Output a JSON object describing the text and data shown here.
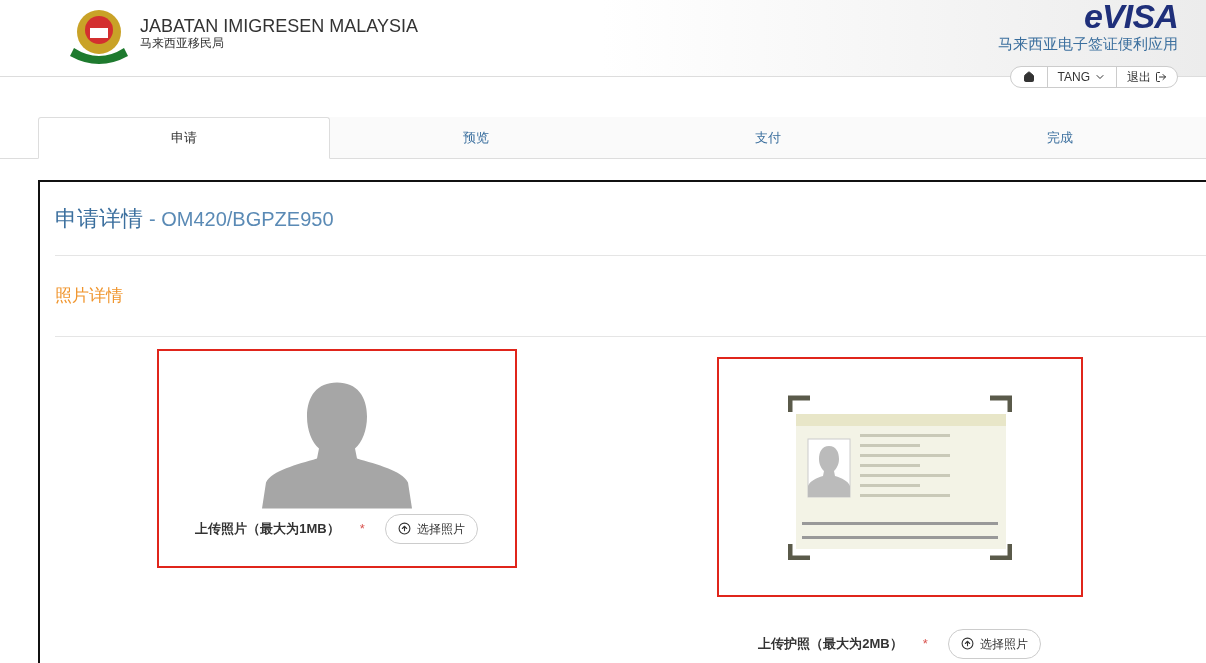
{
  "header": {
    "agency": "JABATAN IMIGRESEN MALAYSIA",
    "agency_zh": "马来西亚移民局",
    "logo_text": "eVISA",
    "app_name": "马来西亚电子签证便利应用",
    "user_menu": {
      "user": "TANG",
      "logout": "退出"
    }
  },
  "steps": [
    {
      "label": "申请",
      "selected": true
    },
    {
      "label": "预览",
      "selected": false
    },
    {
      "label": "支付",
      "selected": false
    },
    {
      "label": "完成",
      "selected": false
    }
  ],
  "panel": {
    "title": "申请详情",
    "reference": "- OM420/BGPZE950",
    "section": "照片详情",
    "uploads": [
      {
        "kind": "photo",
        "label": "上传照片（最大为1MB）",
        "required": "*",
        "button": "选择照片"
      },
      {
        "kind": "passport",
        "label": "上传护照（最大为2MB）",
        "required": "*",
        "button": "选择照片"
      }
    ]
  }
}
